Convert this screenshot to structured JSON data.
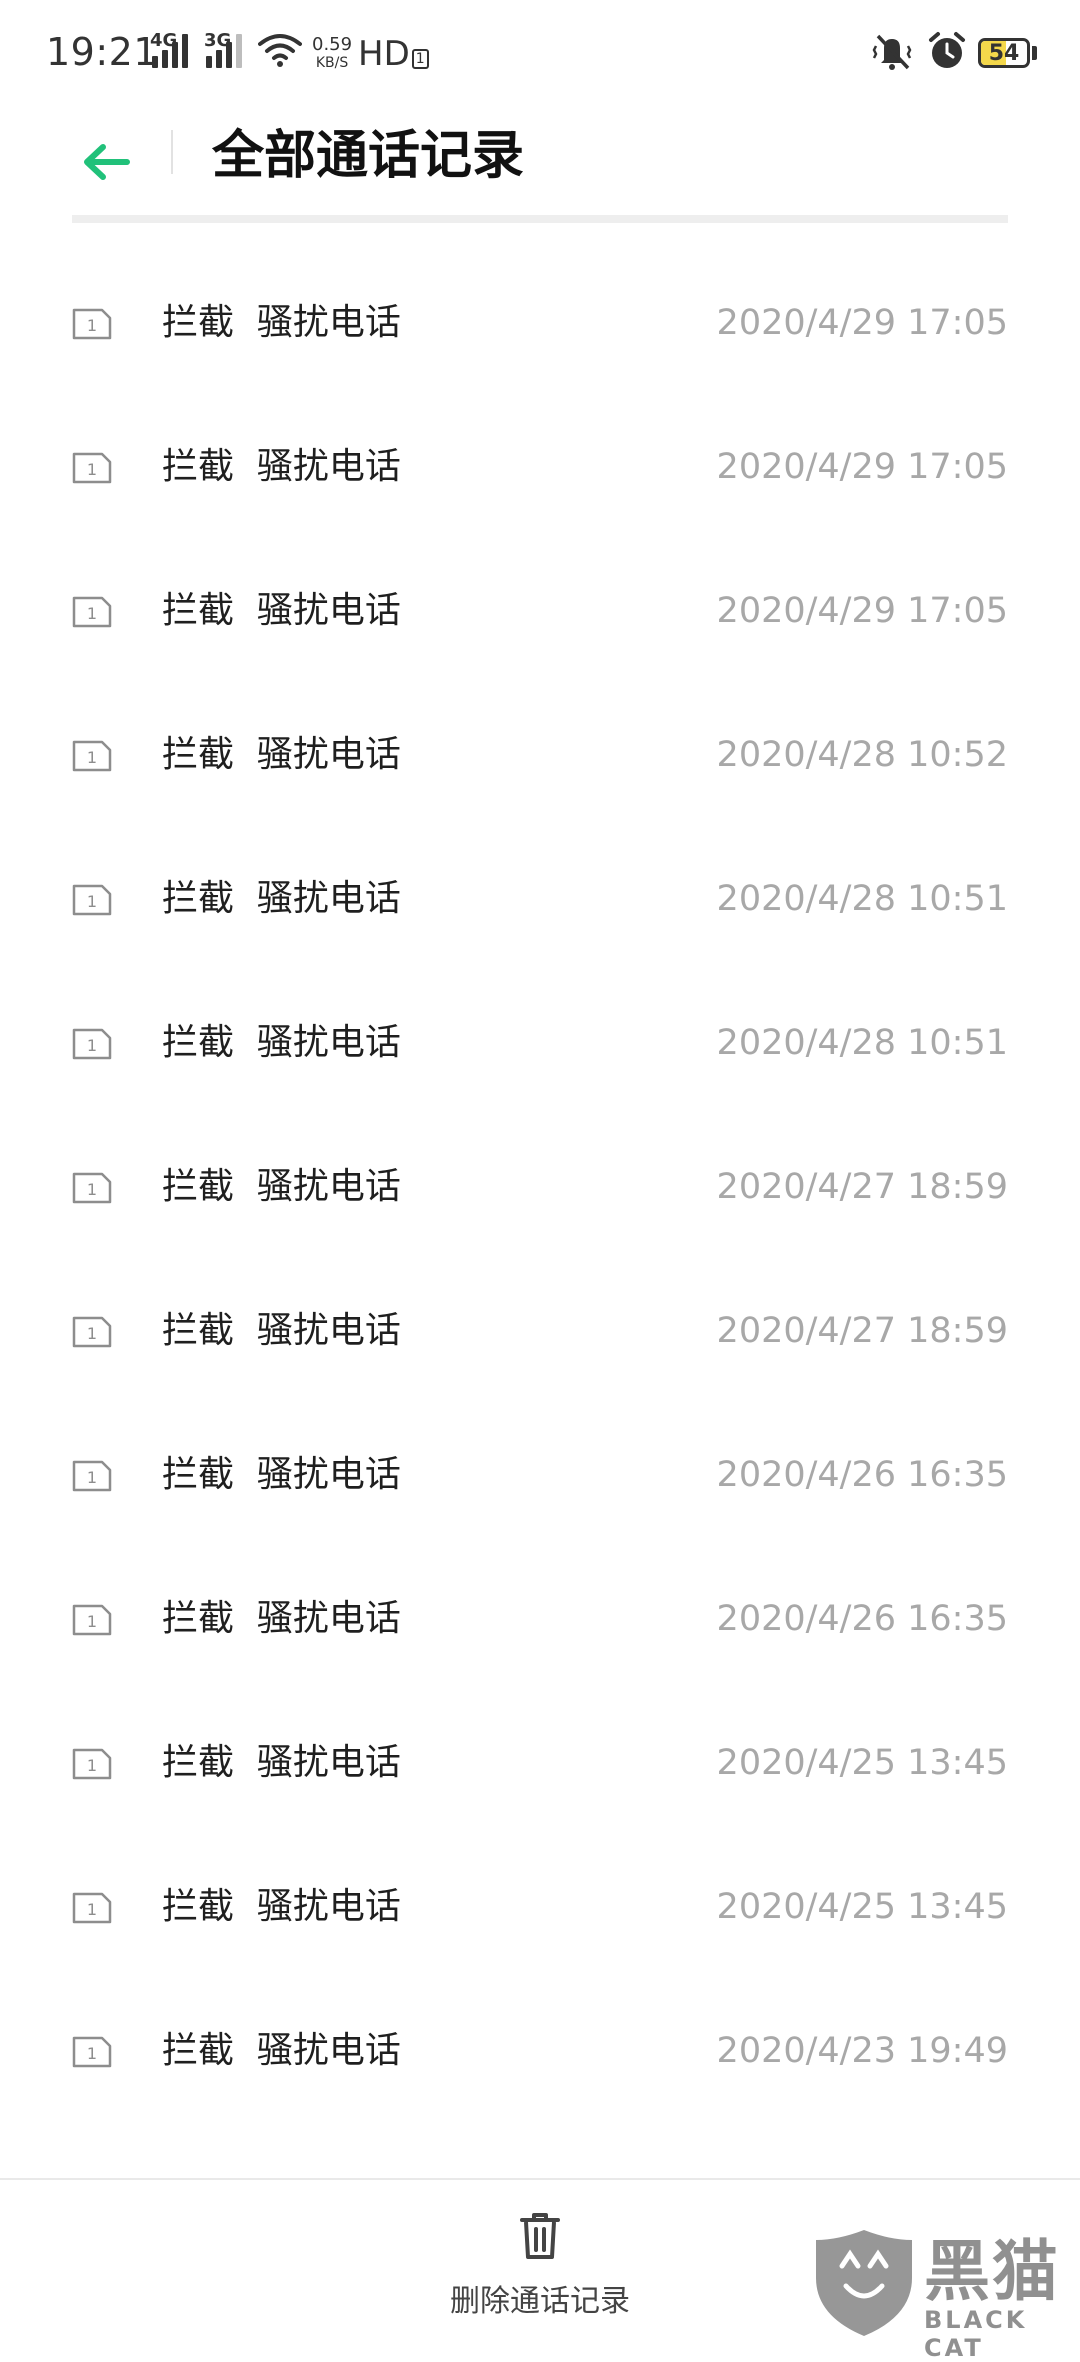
{
  "status_bar": {
    "time": "19:21",
    "net1": "4G",
    "net2": "3G",
    "speed_value": "0.59",
    "speed_unit": "KB/S",
    "hd": "HD",
    "hd_sub": "1",
    "battery_level": "54",
    "battery_fraction": 0.54,
    "battery_color": "#f4d84b"
  },
  "header": {
    "title": "全部通话记录",
    "accent_color": "#21c17a",
    "back_icon": "arrow-left-icon"
  },
  "calls": [
    {
      "label": "拦截  骚扰电话",
      "time": "2020/4/29 17:05"
    },
    {
      "label": "拦截  骚扰电话",
      "time": "2020/4/29 17:05"
    },
    {
      "label": "拦截  骚扰电话",
      "time": "2020/4/29 17:05"
    },
    {
      "label": "拦截  骚扰电话",
      "time": "2020/4/28 10:52"
    },
    {
      "label": "拦截  骚扰电话",
      "time": "2020/4/28 10:51"
    },
    {
      "label": "拦截  骚扰电话",
      "time": "2020/4/28 10:51"
    },
    {
      "label": "拦截  骚扰电话",
      "time": "2020/4/27 18:59"
    },
    {
      "label": "拦截  骚扰电话",
      "time": "2020/4/27 18:59"
    },
    {
      "label": "拦截  骚扰电话",
      "time": "2020/4/26 16:35"
    },
    {
      "label": "拦截  骚扰电话",
      "time": "2020/4/26 16:35"
    },
    {
      "label": "拦截  骚扰电话",
      "time": "2020/4/25 13:45"
    },
    {
      "label": "拦截  骚扰电话",
      "time": "2020/4/25 13:45"
    },
    {
      "label": "拦截  骚扰电话",
      "time": "2020/4/23 19:49"
    }
  ],
  "sim_slot": "1",
  "bottom_bar": {
    "delete_label": "删除通话记录",
    "delete_icon": "trash-icon"
  },
  "watermark": {
    "text": "黑猫",
    "sub": "BLACK CAT"
  }
}
